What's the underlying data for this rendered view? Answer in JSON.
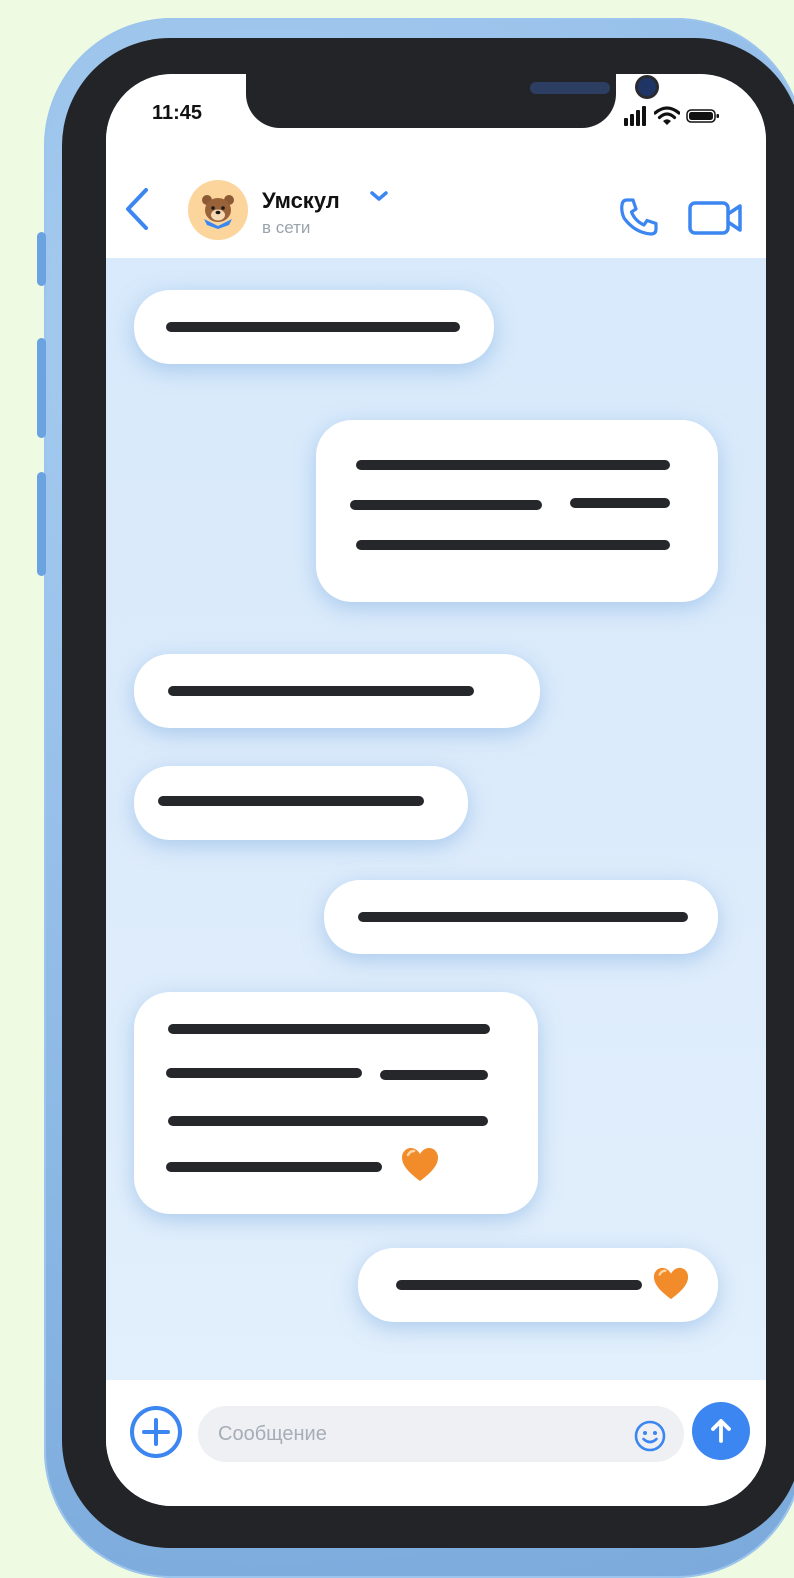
{
  "status_bar": {
    "time": "11:45"
  },
  "header": {
    "contact_name": "Умскул",
    "contact_status": "в сети"
  },
  "input": {
    "placeholder": "Сообщение"
  },
  "icons": {
    "back": "chevron-left-icon",
    "expand": "chevron-down-icon",
    "call": "phone-icon",
    "video": "video-camera-icon",
    "attach": "plus-circle-icon",
    "emoji": "smiley-icon",
    "send": "arrow-up-icon",
    "reaction": "orange-heart-icon"
  },
  "colors": {
    "accent": "#3c86f2",
    "chat_background": "#d9eafb",
    "page_background": "#eefbe2",
    "heart": "#f28b2a"
  }
}
